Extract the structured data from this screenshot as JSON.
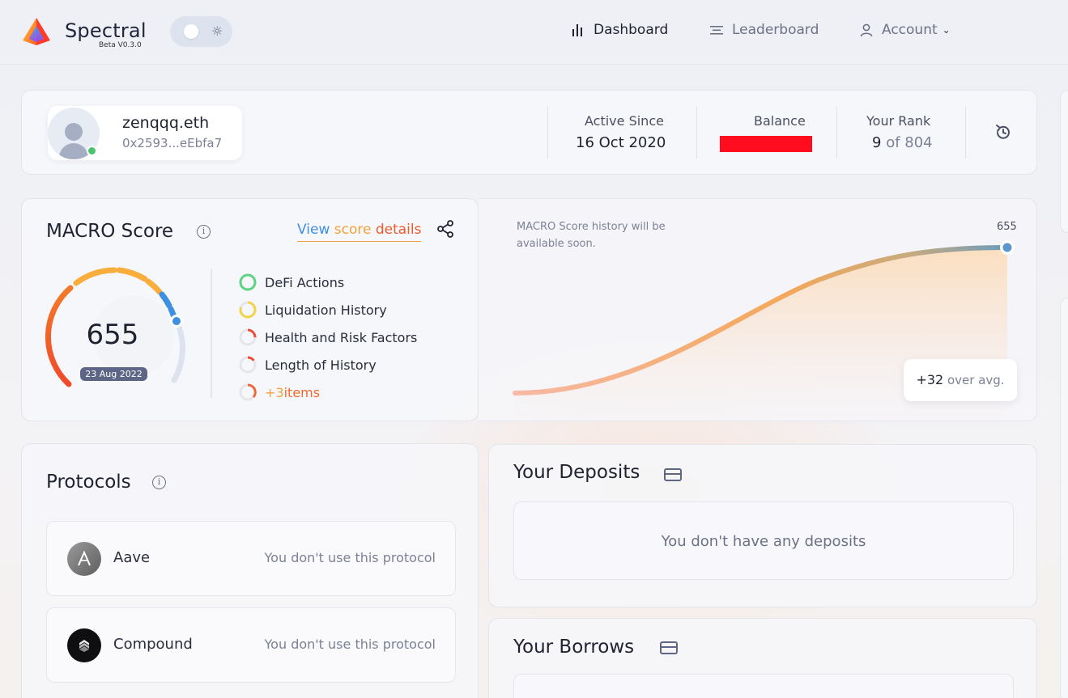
{
  "app": {
    "brand": "Spectral",
    "version": "Beta V0.3.0"
  },
  "nav": {
    "dashboard": "Dashboard",
    "leaderboard": "Leaderboard",
    "account": "Account"
  },
  "profile": {
    "name": "zenqqq.eth",
    "address": "0x2593...eEbfa7",
    "active_since_label": "Active Since",
    "active_since_value": "16 Oct 2020",
    "balance_label": "Balance",
    "rank_label": "Your Rank",
    "rank_value": "9",
    "rank_total": "of 804"
  },
  "macro": {
    "title": "MACRO Score",
    "view_link": {
      "a": "View ",
      "b": "score ",
      "c": "details"
    },
    "score": "655",
    "date": "23 Aug 2022",
    "factors": [
      {
        "label": "DeFi Actions",
        "color": "#5cd483",
        "progress": 1.0
      },
      {
        "label": "Liquidation History",
        "color": "#f2d34a",
        "progress": 0.8
      },
      {
        "label": "Health and Risk Factors",
        "color": "#ef4b3a",
        "progress": 0.25
      },
      {
        "label": "Length of History",
        "color": "#ef4b3a",
        "progress": 0.15
      }
    ],
    "more": {
      "count": "+3",
      "label": " items"
    }
  },
  "history": {
    "note": "MACRO Score history will be available soon.",
    "end_value": "655",
    "over_avg_value": "+32",
    "over_avg_label": " over avg."
  },
  "protocols": {
    "title": "Protocols",
    "items": [
      {
        "name": "Aave",
        "status": "You don't use this protocol",
        "icon": "aave-icon"
      },
      {
        "name": "Compound",
        "status": "You don't use this protocol",
        "icon": "compound-icon"
      }
    ]
  },
  "deposits": {
    "title": "Your Deposits",
    "empty": "You don't have any deposits"
  },
  "borrows": {
    "title": "Your Borrows"
  },
  "colors": {
    "accent_blue": "#3d8fe0",
    "accent_orange": "#f0a33a",
    "accent_red": "#ee5a2c",
    "online": "#4cc46e"
  }
}
